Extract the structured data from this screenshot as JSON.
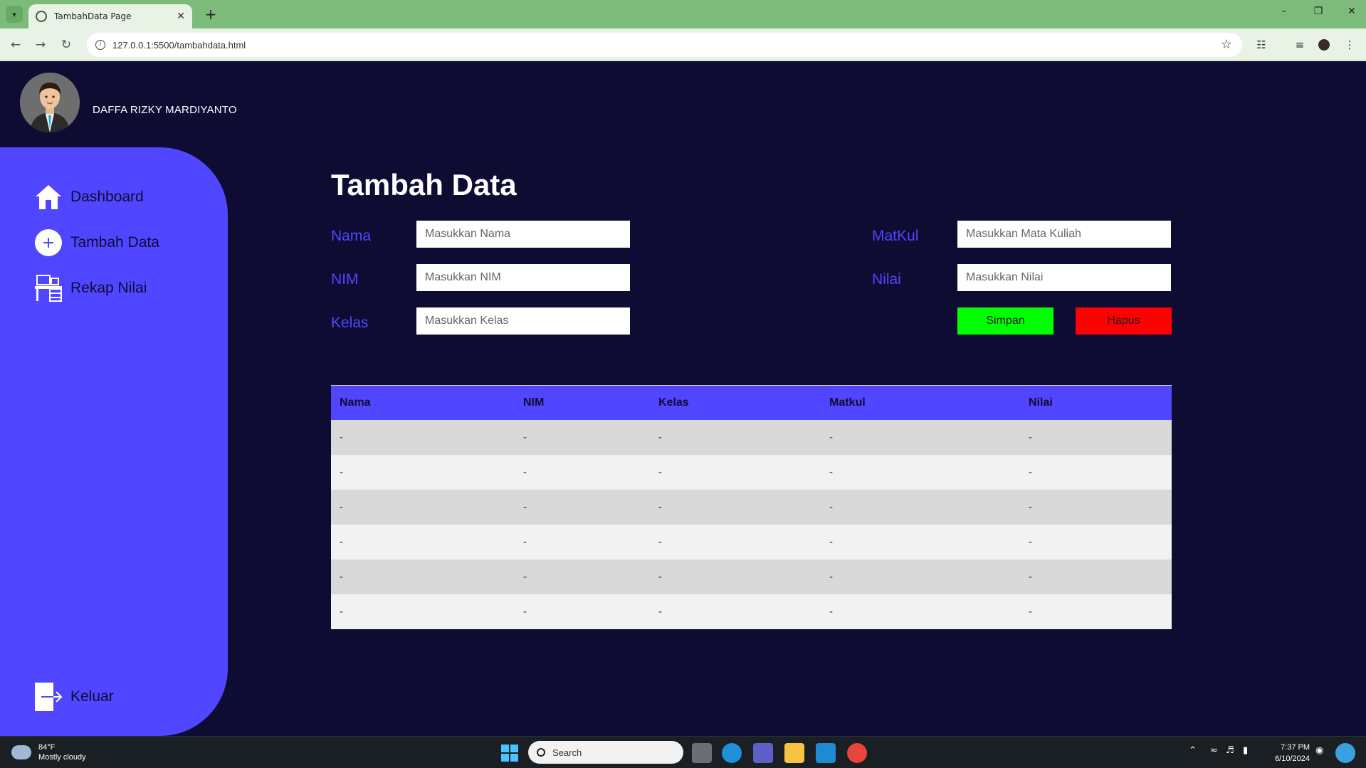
{
  "browser": {
    "tab_title": "TambahData Page",
    "url": "127.0.0.1:5500/tambahdata.html"
  },
  "user": {
    "name": "DAFFA RIZKY MARDIYANTO"
  },
  "sidebar": {
    "items": [
      {
        "label": "Dashboard",
        "icon": "home-icon"
      },
      {
        "label": "Tambah Data",
        "icon": "plus-circle-icon"
      },
      {
        "label": "Rekap Nilai",
        "icon": "desk-icon"
      }
    ],
    "logout": {
      "label": "Keluar",
      "icon": "logout-icon"
    }
  },
  "page": {
    "title": "Tambah Data"
  },
  "form": {
    "nama": {
      "label": "Nama",
      "placeholder": "Masukkan Nama"
    },
    "nim": {
      "label": "NIM",
      "placeholder": "Masukkan NIM"
    },
    "kelas": {
      "label": "Kelas",
      "placeholder": "Masukkan Kelas"
    },
    "matkul": {
      "label": "MatKul",
      "placeholder": "Masukkan Mata Kuliah"
    },
    "nilai": {
      "label": "Nilai",
      "placeholder": "Masukkan Nilai"
    },
    "save_label": "Simpan",
    "delete_label": "Hapus"
  },
  "table": {
    "headers": [
      "Nama",
      "NIM",
      "Kelas",
      "Matkul",
      "Nilai"
    ],
    "rows": [
      [
        "-",
        "-",
        "-",
        "-",
        "-"
      ],
      [
        "-",
        "-",
        "-",
        "-",
        "-"
      ],
      [
        "-",
        "-",
        "-",
        "-",
        "-"
      ],
      [
        "-",
        "-",
        "-",
        "-",
        "-"
      ],
      [
        "-",
        "-",
        "-",
        "-",
        "-"
      ],
      [
        "-",
        "-",
        "-",
        "-",
        "-"
      ]
    ]
  },
  "taskbar": {
    "weather_temp": "84°F",
    "weather_desc": "Mostly cloudy",
    "search_label": "Search",
    "time": "7:37 PM",
    "date": "6/10/2024"
  },
  "colors": {
    "background": "#0f0c33",
    "accent": "#5046ff",
    "save": "#00ff00",
    "delete": "#ff0000"
  }
}
